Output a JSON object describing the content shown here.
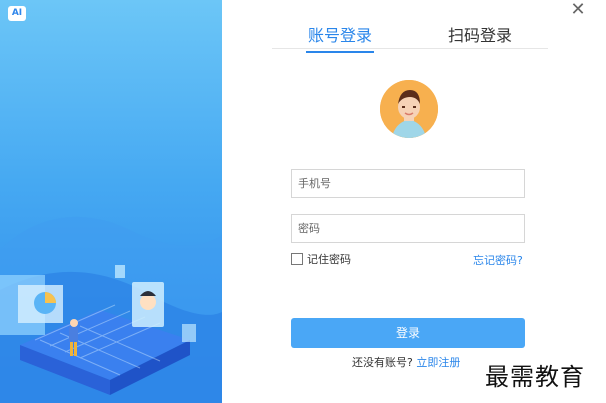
{
  "app": {
    "logo_text": "AI"
  },
  "tabs": {
    "account": "账号登录",
    "scan": "扫码登录"
  },
  "form": {
    "phone_placeholder": "手机号",
    "password_placeholder": "密码",
    "remember_label": "记住密码",
    "forgot_label": "忘记密码?",
    "login_button": "登录",
    "no_account_text": "还没有账号?",
    "register_link": "立即注册"
  },
  "watermark": {
    "text": "最需教育"
  },
  "window": {
    "close_symbol": "✕"
  }
}
